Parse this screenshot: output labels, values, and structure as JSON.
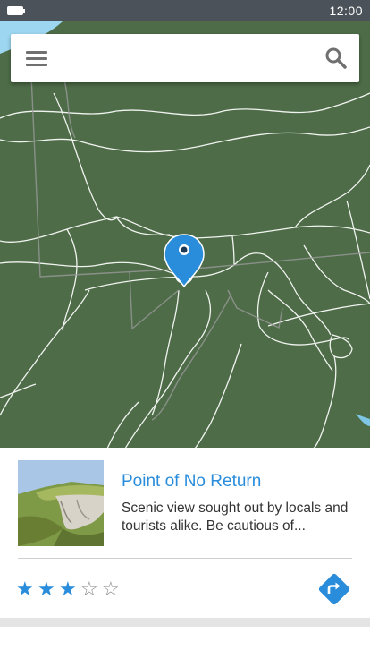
{
  "status": {
    "time": "12:00"
  },
  "search": {
    "value": "",
    "placeholder": ""
  },
  "place": {
    "title": "Point of No Return",
    "description": "Scenic view sought out by locals and tourists alike. Be cautious of...",
    "rating": 3,
    "rating_max": 5
  },
  "colors": {
    "accent": "#2a8ddc",
    "map_land": "#4d6c47",
    "water": "#9dd6f0",
    "status_bar": "#4c525a"
  },
  "icons": {
    "menu": "menu-icon",
    "search": "search-icon",
    "pin": "location-pin-icon",
    "directions": "directions-icon",
    "star_filled": "star-filled-icon",
    "star_empty": "star-outline-icon"
  }
}
